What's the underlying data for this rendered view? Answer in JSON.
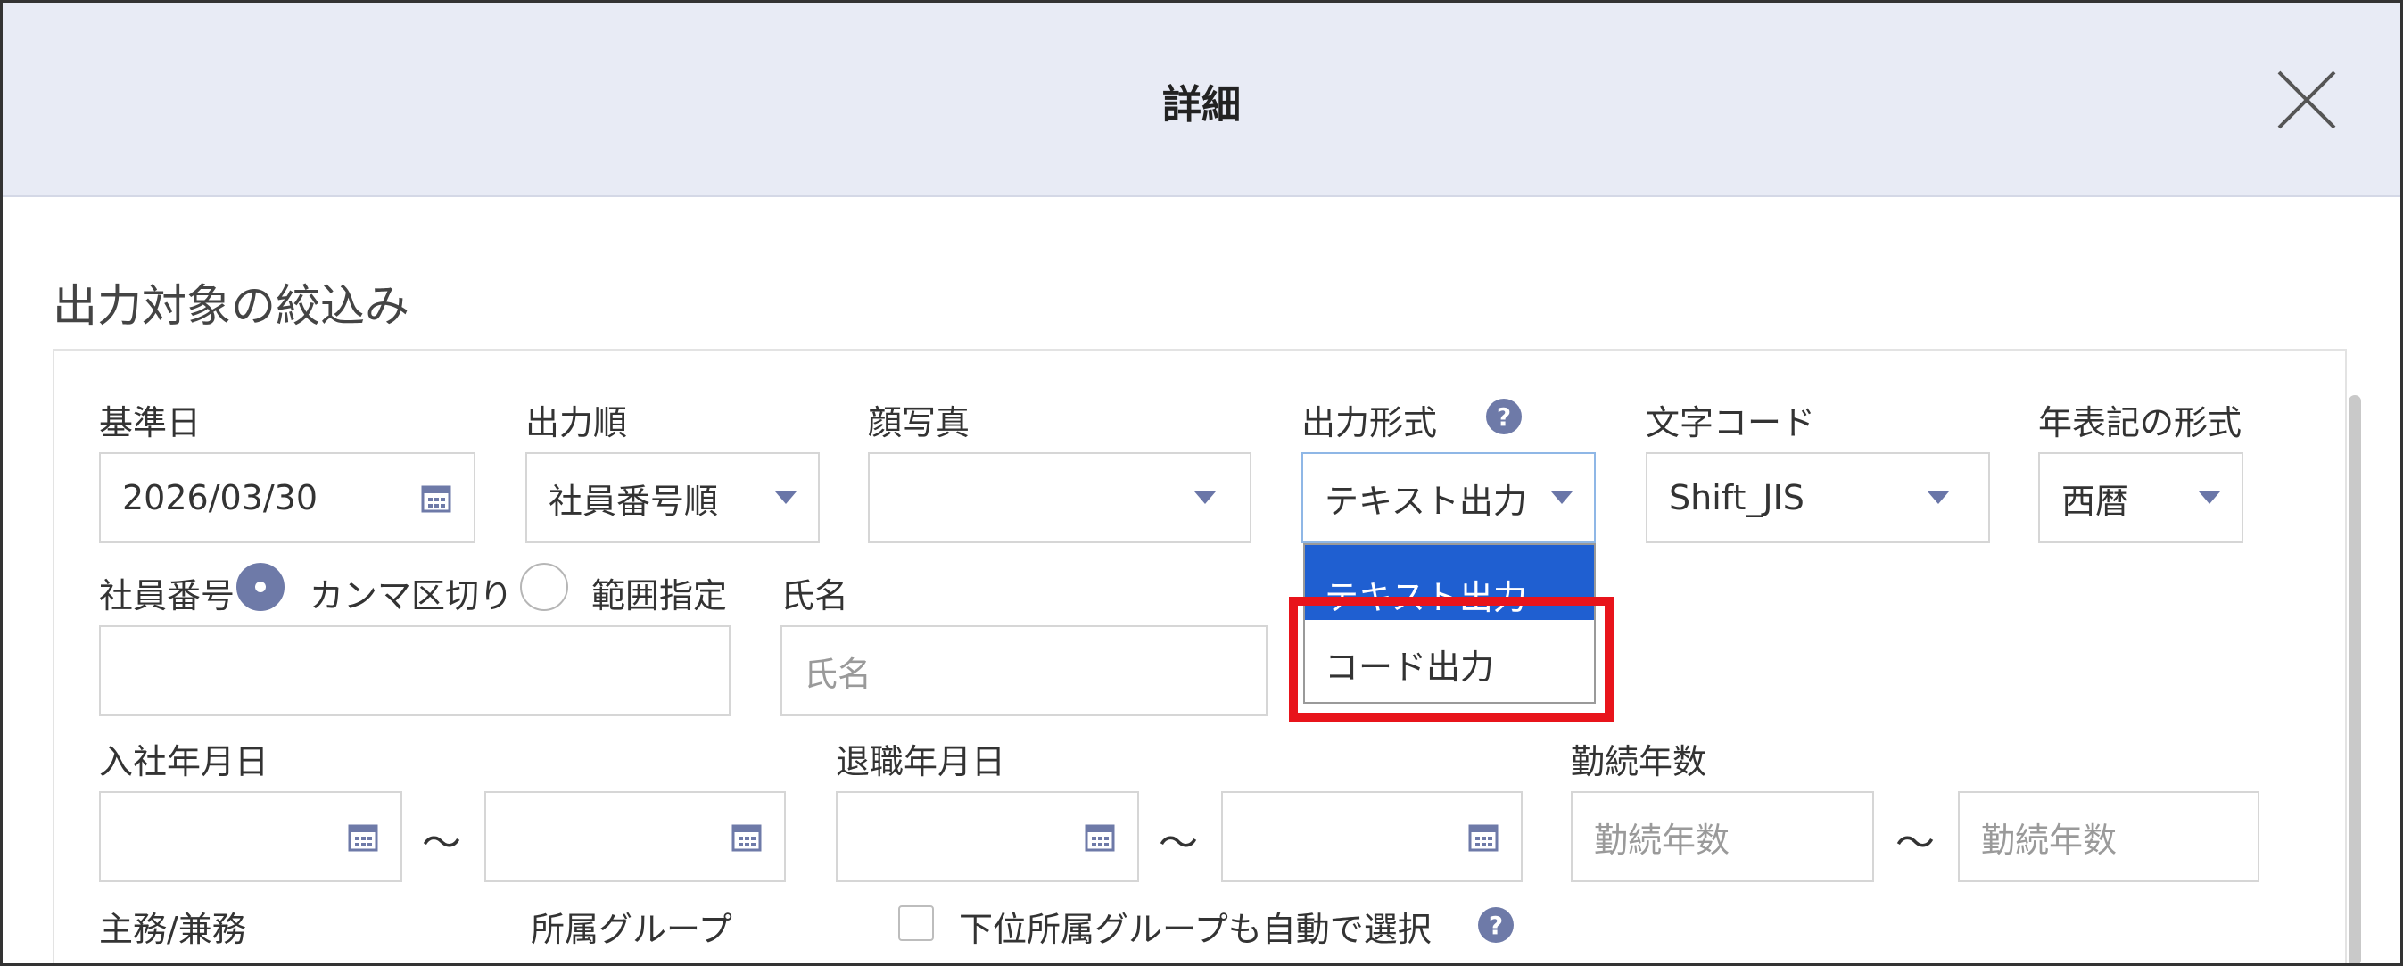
{
  "dialog": {
    "title": "詳細",
    "section_title": "出力対象の絞込み"
  },
  "fields": {
    "base_date": {
      "label": "基準日",
      "value": "2026/03/30"
    },
    "output_order": {
      "label": "出力順",
      "value": "社員番号順"
    },
    "face_photo": {
      "label": "顔写真",
      "value": ""
    },
    "output_format": {
      "label": "出力形式",
      "value": "テキスト出力"
    },
    "char_code": {
      "label": "文字コード",
      "value": "Shift_JIS"
    },
    "year_format": {
      "label": "年表記の形式",
      "value": "西暦"
    },
    "employee_number": {
      "label": "社員番号",
      "option_comma": "カンマ区切り",
      "option_range": "範囲指定",
      "value": ""
    },
    "name": {
      "label": "氏名",
      "placeholder": "氏名"
    },
    "hire_date": {
      "label": "入社年月日",
      "from": "",
      "to": ""
    },
    "retire_date": {
      "label": "退職年月日",
      "from": "",
      "to": ""
    },
    "years_service": {
      "label": "勤続年数",
      "from_placeholder": "勤続年数",
      "to_placeholder": "勤続年数"
    },
    "main_side_job": {
      "label": "主務/兼務"
    },
    "group": {
      "label": "所属グループ",
      "auto_select_label": "下位所属グループも自動で選択"
    },
    "range_separator": "～"
  },
  "format_dropdown": {
    "options": [
      "テキスト出力",
      "コード出力"
    ],
    "selected": "テキスト出力"
  },
  "colors": {
    "header_bg": "#e8ebf5",
    "accent": "#6e7aa8",
    "selected_option": "#1f5fd1",
    "highlight": "#e8141b"
  }
}
